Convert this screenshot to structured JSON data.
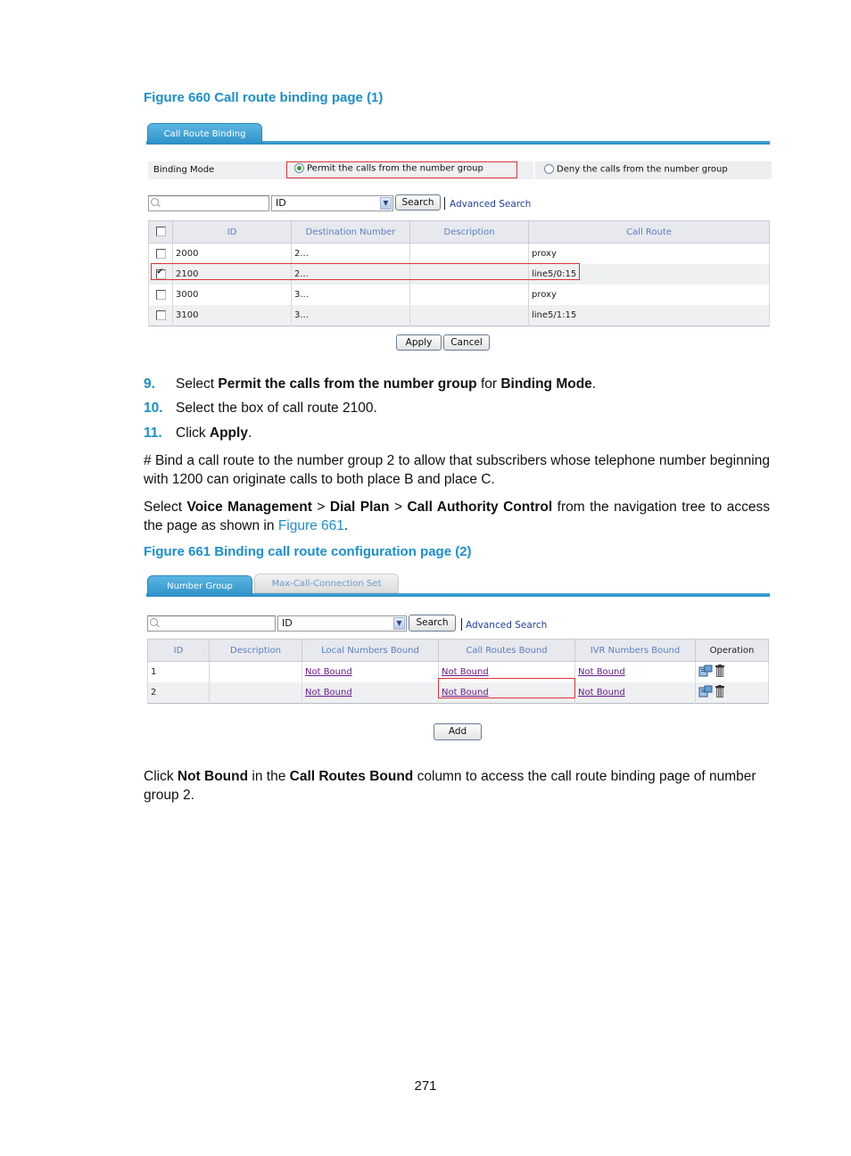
{
  "figure660": {
    "title": "Figure 660 Call route binding page (1)",
    "tab": "Call Route Binding",
    "binding_mode_label": "Binding Mode",
    "permit_option": "Permit the calls from the number group",
    "deny_option": "Deny the calls from the number group",
    "selected_mode": "permit",
    "search_placeholder": "",
    "search_field_value": "ID",
    "search_button": "Search",
    "advanced_search": "Advanced Search",
    "columns": [
      "ID",
      "Destination Number",
      "Description",
      "Call Route"
    ],
    "rows": [
      {
        "checked": false,
        "id": "2000",
        "destination": "2...",
        "description": "",
        "call_route": "proxy"
      },
      {
        "checked": true,
        "id": "2100",
        "destination": "2...",
        "description": "",
        "call_route": "line5/0:15"
      },
      {
        "checked": false,
        "id": "3000",
        "destination": "3...",
        "description": "",
        "call_route": "proxy"
      },
      {
        "checked": false,
        "id": "3100",
        "destination": "3...",
        "description": "",
        "call_route": "line5/1:15"
      }
    ],
    "apply_button": "Apply",
    "cancel_button": "Cancel"
  },
  "steps": [
    {
      "num": "9.",
      "parts": [
        [
          "Select ",
          false
        ],
        [
          "Permit the calls from the number group",
          true
        ],
        [
          " for ",
          false
        ],
        [
          "Binding Mode",
          true
        ],
        [
          ".",
          false
        ]
      ]
    },
    {
      "num": "10.",
      "parts": [
        [
          "Select the box of call route 2100.",
          false
        ]
      ]
    },
    {
      "num": "11.",
      "parts": [
        [
          "Click ",
          false
        ],
        [
          "Apply",
          true
        ],
        [
          ".",
          false
        ]
      ]
    }
  ],
  "para1": "# Bind a call route to the number group 2 to allow that subscribers whose telephone number beginning with 1200 can originate calls to both place B and place C.",
  "para2": {
    "pre": "Select ",
    "b1": "Voice Management",
    "gt1": " > ",
    "b2": "Dial Plan",
    "gt2": " > ",
    "b3": "Call Authority Control",
    "post": " from the navigation tree to access the page as shown in ",
    "link": "Figure 661",
    "end": "."
  },
  "figure661": {
    "title": "Figure 661 Binding call route configuration page (2)",
    "tabs": [
      "Number Group",
      "Max-Call-Connection Set"
    ],
    "active_tab": 0,
    "search_field_value": "ID",
    "search_button": "Search",
    "advanced_search": "Advanced Search",
    "columns": [
      "ID",
      "Description",
      "Local Numbers Bound",
      "Call Routes Bound",
      "IVR Numbers Bound",
      "Operation"
    ],
    "rows": [
      {
        "id": "1",
        "description": "",
        "local": "Not Bound",
        "call_routes": "Not Bound",
        "ivr": "Not Bound",
        "ops": [
          "edit-icon",
          "delete-icon"
        ]
      },
      {
        "id": "2",
        "description": "",
        "local": "Not Bound",
        "call_routes": "Not Bound",
        "ivr": "Not Bound",
        "ops": [
          "edit-icon",
          "delete-icon"
        ]
      }
    ],
    "add_button": "Add"
  },
  "para3": {
    "pre": "Click ",
    "b1": "Not Bound",
    "mid": " in the ",
    "b2": "Call Routes Bound",
    "post": " column to access the call route binding page of number group 2."
  },
  "page_number": "271"
}
